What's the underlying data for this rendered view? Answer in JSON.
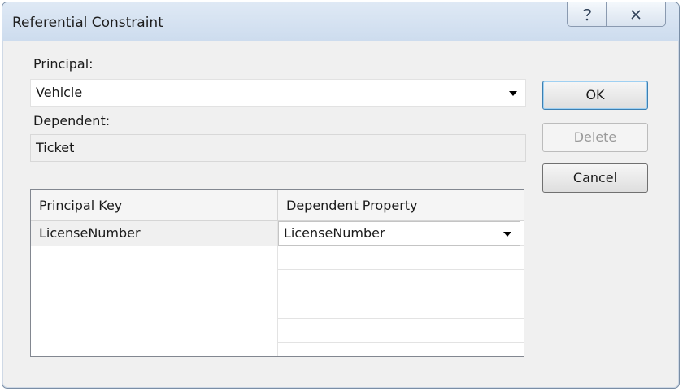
{
  "window": {
    "title": "Referential Constraint",
    "help_glyph": "?",
    "close_glyph": "✕"
  },
  "form": {
    "principal_label": "Principal:",
    "principal_value": "Vehicle",
    "dependent_label": "Dependent:",
    "dependent_value": "Ticket"
  },
  "buttons": {
    "ok": "OK",
    "delete": "Delete",
    "cancel": "Cancel"
  },
  "grid": {
    "columns": [
      "Principal Key",
      "Dependent Property"
    ],
    "rows": [
      {
        "principal_key": "LicenseNumber",
        "dependent_property": "LicenseNumber"
      }
    ]
  },
  "icons": {
    "help": "help-icon",
    "close": "close-icon",
    "dropdown": "chevron-down-icon"
  }
}
